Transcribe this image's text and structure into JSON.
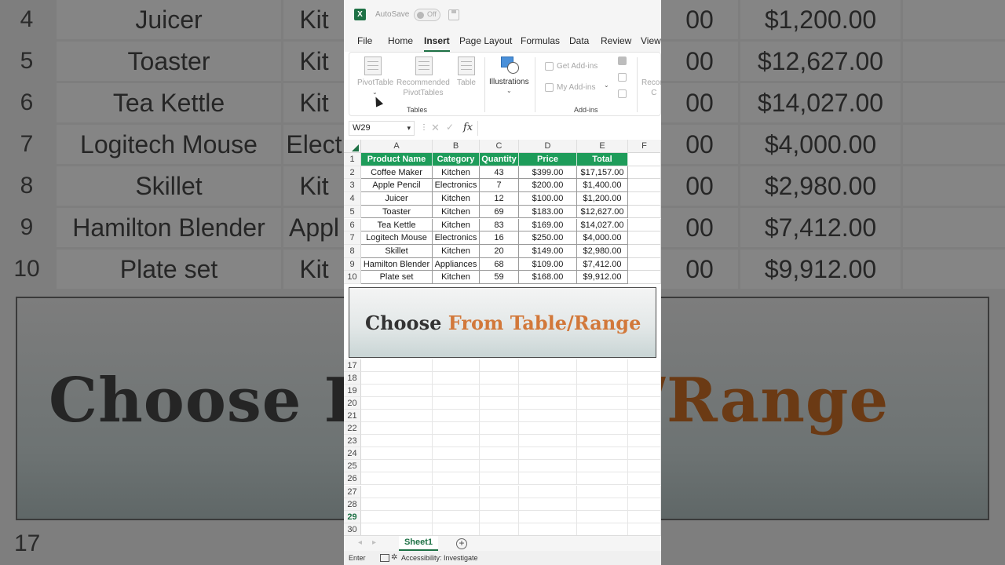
{
  "background": {
    "rows": [
      {
        "num": "4",
        "name": "Juicer",
        "cat": "Kit",
        "price": "00",
        "total": "$1,200.00"
      },
      {
        "num": "5",
        "name": "Toaster",
        "cat": "Kit",
        "price": "00",
        "total": "$12,627.00"
      },
      {
        "num": "6",
        "name": "Tea Kettle",
        "cat": "Kit",
        "price": "00",
        "total": "$14,027.00"
      },
      {
        "num": "7",
        "name": "Logitech Mouse",
        "cat": "Elect",
        "price": "00",
        "total": "$4,000.00"
      },
      {
        "num": "8",
        "name": "Skillet",
        "cat": "Kit",
        "price": "00",
        "total": "$2,980.00"
      },
      {
        "num": "9",
        "name": "Hamilton Blender",
        "cat": "Appl",
        "price": "00",
        "total": "$7,412.00"
      },
      {
        "num": "10",
        "name": "Plate set",
        "cat": "Kit",
        "price": "00",
        "total": "$9,912.00"
      }
    ],
    "banner_left": "Choose F",
    "banner_right": "e/Range",
    "bottom_row": "17"
  },
  "titlebar": {
    "app_icon": "excel-icon",
    "autosave_label": "AutoSave",
    "autosave_state": "Off"
  },
  "menu": {
    "items": [
      "File",
      "Home",
      "Insert",
      "Page Layout",
      "Formulas",
      "Data",
      "Review",
      "View"
    ],
    "active": "Insert"
  },
  "ribbon": {
    "pivottable": "PivotTable",
    "recommended_1": "Recommended",
    "recommended_2": "PivotTables",
    "table": "Table",
    "tables_group": "Tables",
    "illustrations": "Illustrations",
    "get_addins": "Get Add-ins",
    "my_addins": "My Add-ins",
    "addins_group": "Add-ins",
    "reco_1": "Recom",
    "reco_2": "C"
  },
  "formula_bar": {
    "name_box": "W29",
    "fx": "fx",
    "value": ""
  },
  "sheet": {
    "columns": [
      "A",
      "B",
      "C",
      "D",
      "E",
      "F"
    ],
    "headers": [
      "Product Name",
      "Category",
      "Quantity",
      "Price",
      "Total"
    ],
    "rows": [
      [
        "Coffee Maker",
        "Kitchen",
        "43",
        "$399.00",
        "$17,157.00"
      ],
      [
        "Apple Pencil",
        "Electronics",
        "7",
        "$200.00",
        "$1,400.00"
      ],
      [
        "Juicer",
        "Kitchen",
        "12",
        "$100.00",
        "$1,200.00"
      ],
      [
        "Toaster",
        "Kitchen",
        "69",
        "$183.00",
        "$12,627.00"
      ],
      [
        "Tea Kettle",
        "Kitchen",
        "83",
        "$169.00",
        "$14,027.00"
      ],
      [
        "Logitech Mouse",
        "Electronics",
        "16",
        "$250.00",
        "$4,000.00"
      ],
      [
        "Skillet",
        "Kitchen",
        "20",
        "$149.00",
        "$2,980.00"
      ],
      [
        "Hamilton Blender",
        "Appliances",
        "68",
        "$109.00",
        "$7,412.00"
      ],
      [
        "Plate set",
        "Kitchen",
        "59",
        "$168.00",
        "$9,912.00"
      ]
    ],
    "top_row_numbers": [
      "1",
      "2",
      "3",
      "4",
      "5",
      "6",
      "7",
      "8",
      "9",
      "10"
    ],
    "lower_row_numbers": [
      "17",
      "18",
      "19",
      "20",
      "21",
      "22",
      "23",
      "24",
      "25",
      "26",
      "27",
      "28",
      "29",
      "30"
    ],
    "selected_row": "29"
  },
  "overlay_banner": {
    "word1": "Choose",
    "word2": "From Table/Range"
  },
  "sheet_tabs": {
    "active": "Sheet1"
  },
  "status": {
    "mode": "Enter",
    "accessibility": "Accessibility: Investigate"
  },
  "colors": {
    "header_green": "#1e9c5a",
    "excel_green": "#1e7145",
    "accent_orange": "#d2783a"
  }
}
